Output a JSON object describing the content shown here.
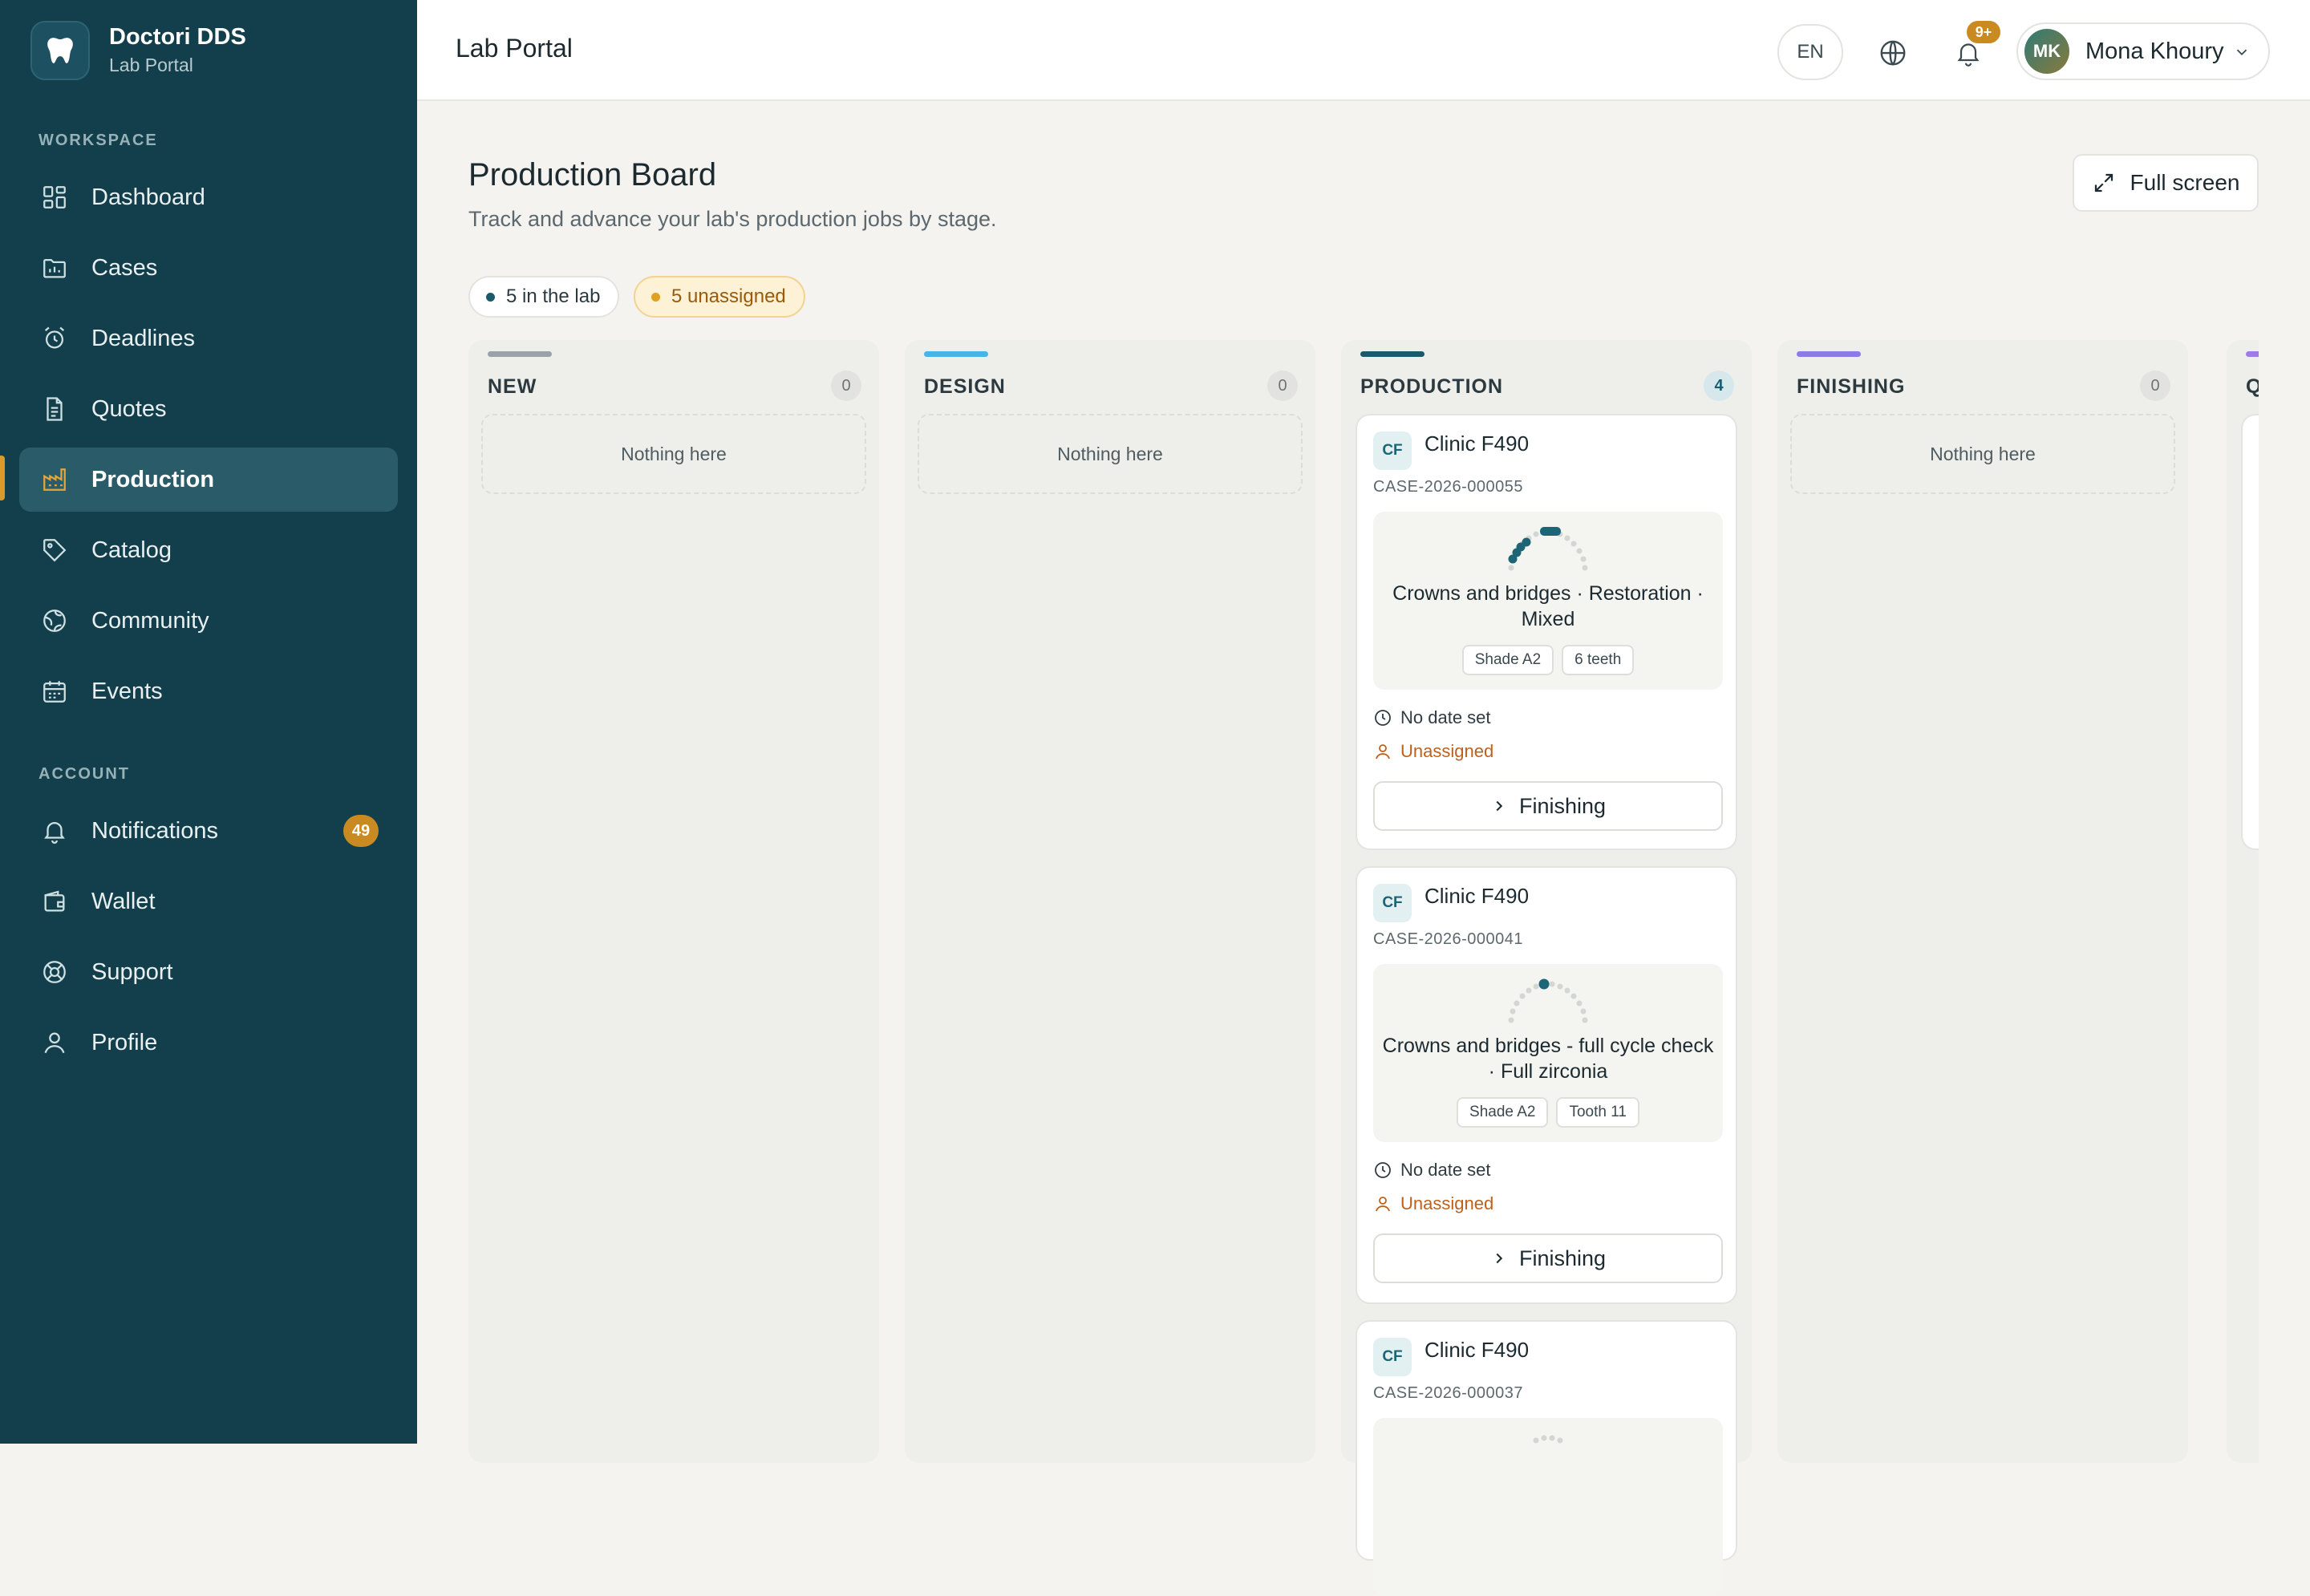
{
  "brand": {
    "name": "Doctori DDS",
    "subtitle": "Lab Portal"
  },
  "sidebar": {
    "workspace_label": "WORKSPACE",
    "account_label": "ACCOUNT",
    "workspace_items": [
      {
        "label": "Dashboard",
        "icon": "grid-icon"
      },
      {
        "label": "Cases",
        "icon": "folder-icon"
      },
      {
        "label": "Deadlines",
        "icon": "alarm-clock-icon"
      },
      {
        "label": "Quotes",
        "icon": "document-icon"
      },
      {
        "label": "Production",
        "icon": "factory-icon",
        "active": true
      },
      {
        "label": "Catalog",
        "icon": "tag-icon"
      },
      {
        "label": "Community",
        "icon": "globe-icon"
      },
      {
        "label": "Events",
        "icon": "calendar-icon"
      }
    ],
    "account_items": [
      {
        "label": "Notifications",
        "icon": "bell-icon",
        "badge": "49"
      },
      {
        "label": "Wallet",
        "icon": "wallet-icon"
      },
      {
        "label": "Support",
        "icon": "lifebuoy-icon"
      },
      {
        "label": "Profile",
        "icon": "user-icon"
      }
    ]
  },
  "topbar": {
    "title": "Lab Portal",
    "language": "EN",
    "notifications_badge": "9+",
    "user": {
      "initials": "MK",
      "name": "Mona Khoury"
    }
  },
  "page": {
    "title": "Production Board",
    "subtitle": "Track and advance your lab's production jobs by stage.",
    "fullscreen_label": "Full screen",
    "chips": {
      "in_lab": "5 in the lab",
      "unassigned": "5 unassigned"
    }
  },
  "columns": [
    {
      "title": "NEW",
      "count": "0",
      "accent": "#9aa3a8",
      "empty": "Nothing here"
    },
    {
      "title": "DESIGN",
      "count": "0",
      "accent": "#45b4e6",
      "empty": "Nothing here"
    },
    {
      "title": "PRODUCTION",
      "count": "4",
      "accent": "#1b5a6b"
    },
    {
      "title": "FINISHING",
      "count": "0",
      "accent": "#8a7be8",
      "empty": "Nothing here"
    },
    {
      "title": "QU",
      "accent": "#a07ae6"
    }
  ],
  "cards": [
    {
      "initials": "CF",
      "clinic": "Clinic F490",
      "case_id": "CASE-2026-000055",
      "description": "Crowns and bridges · Restoration · Mixed",
      "tags": [
        "Shade A2",
        "6 teeth"
      ],
      "date": "No date set",
      "assignee": "Unassigned",
      "next_stage": "Finishing"
    },
    {
      "initials": "CF",
      "clinic": "Clinic F490",
      "case_id": "CASE-2026-000041",
      "description": "Crowns and bridges - full cycle check · Full zirconia",
      "tags": [
        "Shade A2",
        "Tooth 11"
      ],
      "date": "No date set",
      "assignee": "Unassigned",
      "next_stage": "Finishing"
    },
    {
      "initials": "CF",
      "clinic": "Clinic F490",
      "case_id": "CASE-2026-000037"
    }
  ],
  "colors": {
    "sidebar": "#123f4b",
    "accent": "#c98a22",
    "unassigned": "#c0601a"
  }
}
